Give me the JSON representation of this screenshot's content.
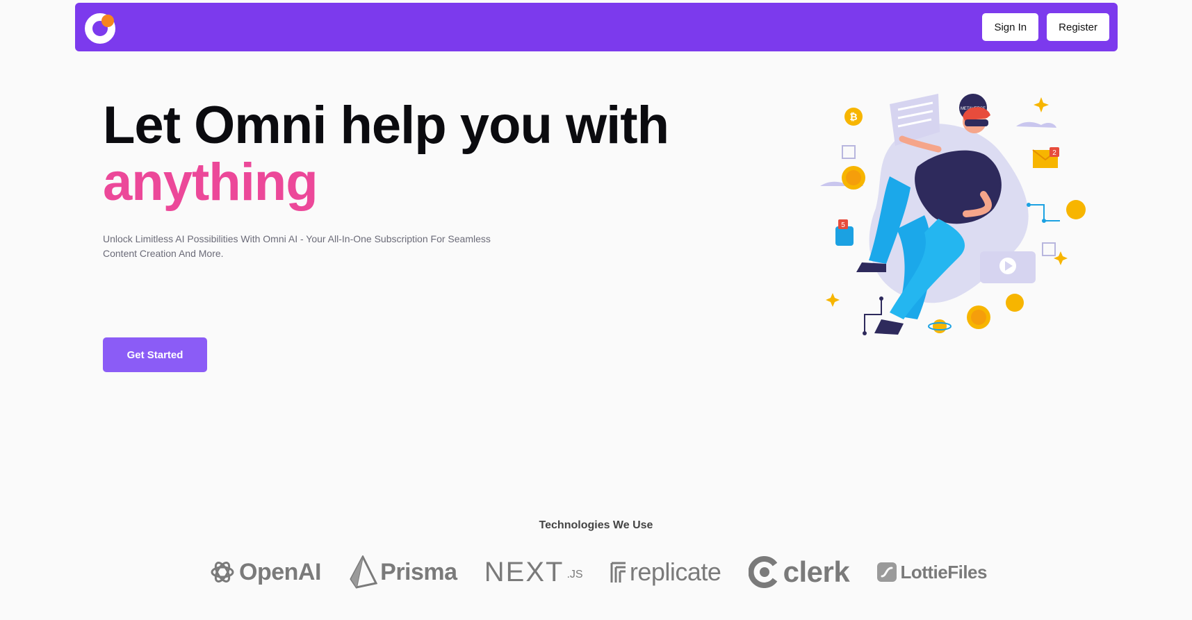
{
  "navbar": {
    "logo_colors": {
      "ring": "#ffffff",
      "dot": "#f6851f",
      "background": "#7c3aed"
    },
    "sign_in_label": "Sign In",
    "register_label": "Register"
  },
  "hero": {
    "title_line1": "Let Omni help you with",
    "title_line2": "anything",
    "title_accent_color": "#ec4899",
    "subtitle": "Unlock Limitless AI Possibilities With Omni AI - Your All-In-One Subscription For Seamless Content Creation And More.",
    "cta_label": "Get Started",
    "cta_color": "#8b5cf6",
    "illustration_badge": "METAVERSE",
    "illustration_notification_count": "2",
    "illustration_phone_badge": "5"
  },
  "technologies": {
    "heading": "Technologies We Use",
    "logos": [
      {
        "name": "OpenAI",
        "icon": "openai-knot-icon"
      },
      {
        "name": "Prisma",
        "icon": "prisma-triangle-icon"
      },
      {
        "name": "NEXT",
        "suffix": ".JS",
        "icon": "nextjs-wordmark"
      },
      {
        "name": "replicate",
        "icon": "replicate-icon"
      },
      {
        "name": "clerk",
        "icon": "clerk-icon"
      },
      {
        "name": "LottieFiles",
        "icon": "lottie-icon"
      }
    ]
  }
}
